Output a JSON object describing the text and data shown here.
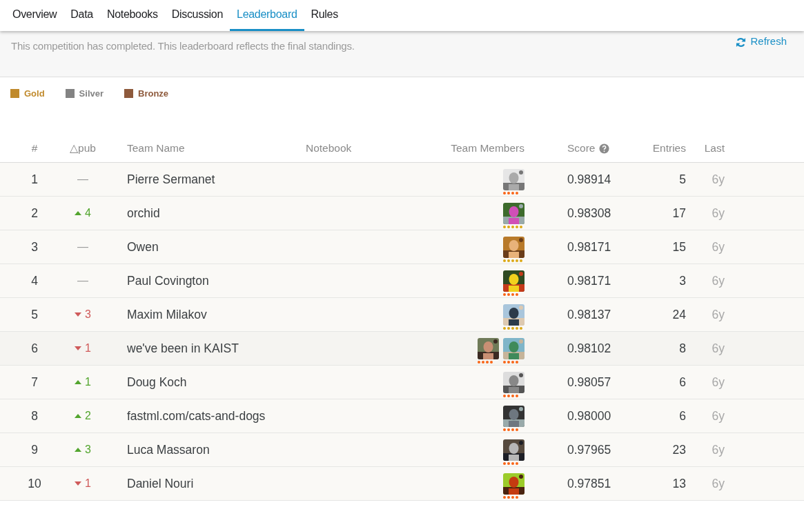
{
  "tabs": [
    {
      "label": "Overview",
      "selected": false
    },
    {
      "label": "Data",
      "selected": false
    },
    {
      "label": "Notebooks",
      "selected": false
    },
    {
      "label": "Discussion",
      "selected": false
    },
    {
      "label": "Leaderboard",
      "selected": true
    },
    {
      "label": "Rules",
      "selected": false
    }
  ],
  "banner": {
    "message": "This competition has completed. This leaderboard reflects the final standings.",
    "refresh": "Refresh"
  },
  "legend": [
    {
      "label": "Gold",
      "color": "#c08a2c"
    },
    {
      "label": "Silver",
      "color": "#838383"
    },
    {
      "label": "Bronze",
      "color": "#8e5a3c"
    }
  ],
  "table": {
    "columns": [
      "#",
      "△pub",
      "Team Name",
      "Notebook",
      "Team Members",
      "Score",
      "Entries",
      "Last"
    ],
    "rows": [
      {
        "rank": "1",
        "delta": {
          "kind": "none",
          "text": "—"
        },
        "team": "Pierre Sermanet",
        "members": [
          {
            "kind": "master"
          }
        ],
        "score": "0.98914",
        "entries": "5",
        "last": "6y"
      },
      {
        "rank": "2",
        "delta": {
          "kind": "up",
          "text": "4"
        },
        "team": "orchid",
        "members": [
          {
            "kind": "grandmaster"
          }
        ],
        "score": "0.98308",
        "entries": "17",
        "last": "6y"
      },
      {
        "rank": "3",
        "delta": {
          "kind": "none",
          "text": "—"
        },
        "team": "Owen",
        "members": [
          {
            "kind": "grandmaster"
          }
        ],
        "score": "0.98171",
        "entries": "15",
        "last": "6y"
      },
      {
        "rank": "4",
        "delta": {
          "kind": "none",
          "text": "—"
        },
        "team": "Paul Covington",
        "members": [
          {
            "kind": "master"
          }
        ],
        "score": "0.98171",
        "entries": "3",
        "last": "6y"
      },
      {
        "rank": "5",
        "delta": {
          "kind": "down",
          "text": "3"
        },
        "team": "Maxim Milakov",
        "members": [
          {
            "kind": "grandmaster"
          }
        ],
        "score": "0.98137",
        "entries": "24",
        "last": "6y"
      },
      {
        "rank": "6",
        "delta": {
          "kind": "down",
          "text": "1"
        },
        "team": "we've been in KAIST",
        "members": [
          {
            "kind": "master"
          },
          {
            "kind": "master"
          }
        ],
        "score": "0.98102",
        "entries": "8",
        "last": "6y"
      },
      {
        "rank": "7",
        "delta": {
          "kind": "up",
          "text": "1"
        },
        "team": "Doug Koch",
        "members": [
          {
            "kind": "master"
          }
        ],
        "score": "0.98057",
        "entries": "6",
        "last": "6y"
      },
      {
        "rank": "8",
        "delta": {
          "kind": "up",
          "text": "2"
        },
        "team": "fastml.com/cats-and-dogs",
        "members": [
          {
            "kind": "master"
          }
        ],
        "score": "0.98000",
        "entries": "6",
        "last": "6y"
      },
      {
        "rank": "9",
        "delta": {
          "kind": "up",
          "text": "3"
        },
        "team": "Luca Massaron",
        "members": [
          {
            "kind": "master"
          }
        ],
        "score": "0.97965",
        "entries": "23",
        "last": "6y"
      },
      {
        "rank": "10",
        "delta": {
          "kind": "down",
          "text": "1"
        },
        "team": "Daniel Nouri",
        "members": [
          {
            "kind": "master"
          }
        ],
        "score": "0.97851",
        "entries": "13",
        "last": "6y"
      }
    ]
  }
}
